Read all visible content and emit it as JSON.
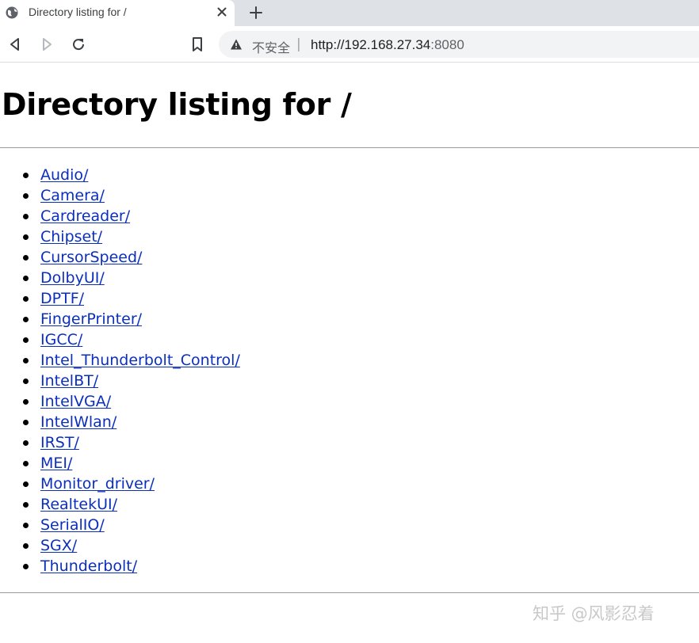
{
  "browser": {
    "tab": {
      "title": "Directory listing for /",
      "favicon": "globe-icon"
    },
    "address_bar": {
      "security_label": "不安全",
      "separator": "|",
      "url_host": "http://192.168.27.34",
      "url_port": ":8080"
    },
    "icons": {
      "back": "back-arrow-icon",
      "forward": "forward-arrow-icon",
      "reload": "reload-icon",
      "bookmark": "bookmark-icon",
      "warning": "warning-icon",
      "close": "close-icon",
      "new_tab": "plus-icon"
    }
  },
  "page": {
    "heading": "Directory listing for /",
    "entries": [
      "Audio/",
      "Camera/",
      "Cardreader/",
      "Chipset/",
      "CursorSpeed/",
      "DolbyUI/",
      "DPTF/",
      "FingerPrinter/",
      "IGCC/",
      "Intel_Thunderbolt_Control/",
      "IntelBT/",
      "IntelVGA/",
      "IntelWlan/",
      "IRST/",
      "MEI/",
      "Monitor_driver/",
      "RealtekUI/",
      "SerialIO/",
      "SGX/",
      "Thunderbolt/"
    ],
    "link_color": "#0b2fbd"
  },
  "watermark": "知乎 @风影忍着"
}
